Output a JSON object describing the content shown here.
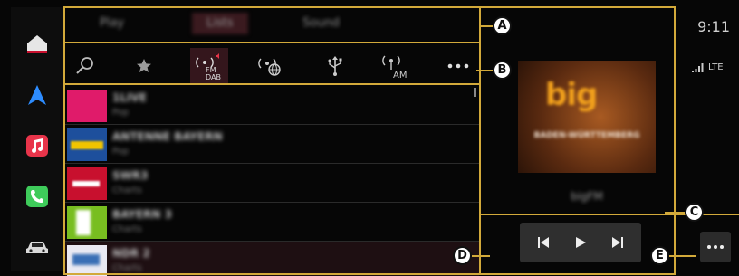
{
  "status": {
    "time": "9:11",
    "network": "LTE"
  },
  "tabs": [
    {
      "label": "Play"
    },
    {
      "label": "Lists"
    },
    {
      "label": "Sound"
    }
  ],
  "sources": [
    {
      "name": "search-icon"
    },
    {
      "name": "favorites-icon"
    },
    {
      "name": "fm-dab-icon",
      "label_top": "FM",
      "label_bottom": "DAB"
    },
    {
      "name": "online-radio-icon"
    },
    {
      "name": "usb-icon"
    },
    {
      "name": "am-icon",
      "label": "AM"
    },
    {
      "name": "more-icon"
    }
  ],
  "stations": [
    {
      "title": "1LIVE",
      "subtitle": "Pop",
      "color": "#e01b6a"
    },
    {
      "title": "ANTENNE BAYERN",
      "subtitle": "Pop",
      "color": "#1d4f9c"
    },
    {
      "title": "SWR3",
      "subtitle": "Charts",
      "color": "#c8102e"
    },
    {
      "title": "BAYERN 3",
      "subtitle": "Charts",
      "color": "#78be20"
    },
    {
      "title": "NDR 2",
      "subtitle": "Charts",
      "color": "#3a6fb5"
    }
  ],
  "now_playing": {
    "station": "bigFM",
    "logo_text": "big",
    "region_text": "BADEN-WÜRTTEMBERG"
  },
  "callouts": [
    "A",
    "B",
    "C",
    "D",
    "E"
  ],
  "colors": {
    "outline": "#d2a93a",
    "active_tab": "#3a1a1f",
    "home": "#e6e6e6",
    "nav": "#2d8cff",
    "music": "#e8344a",
    "phone": "#3ecb5a",
    "car": "#d9d9d9"
  }
}
